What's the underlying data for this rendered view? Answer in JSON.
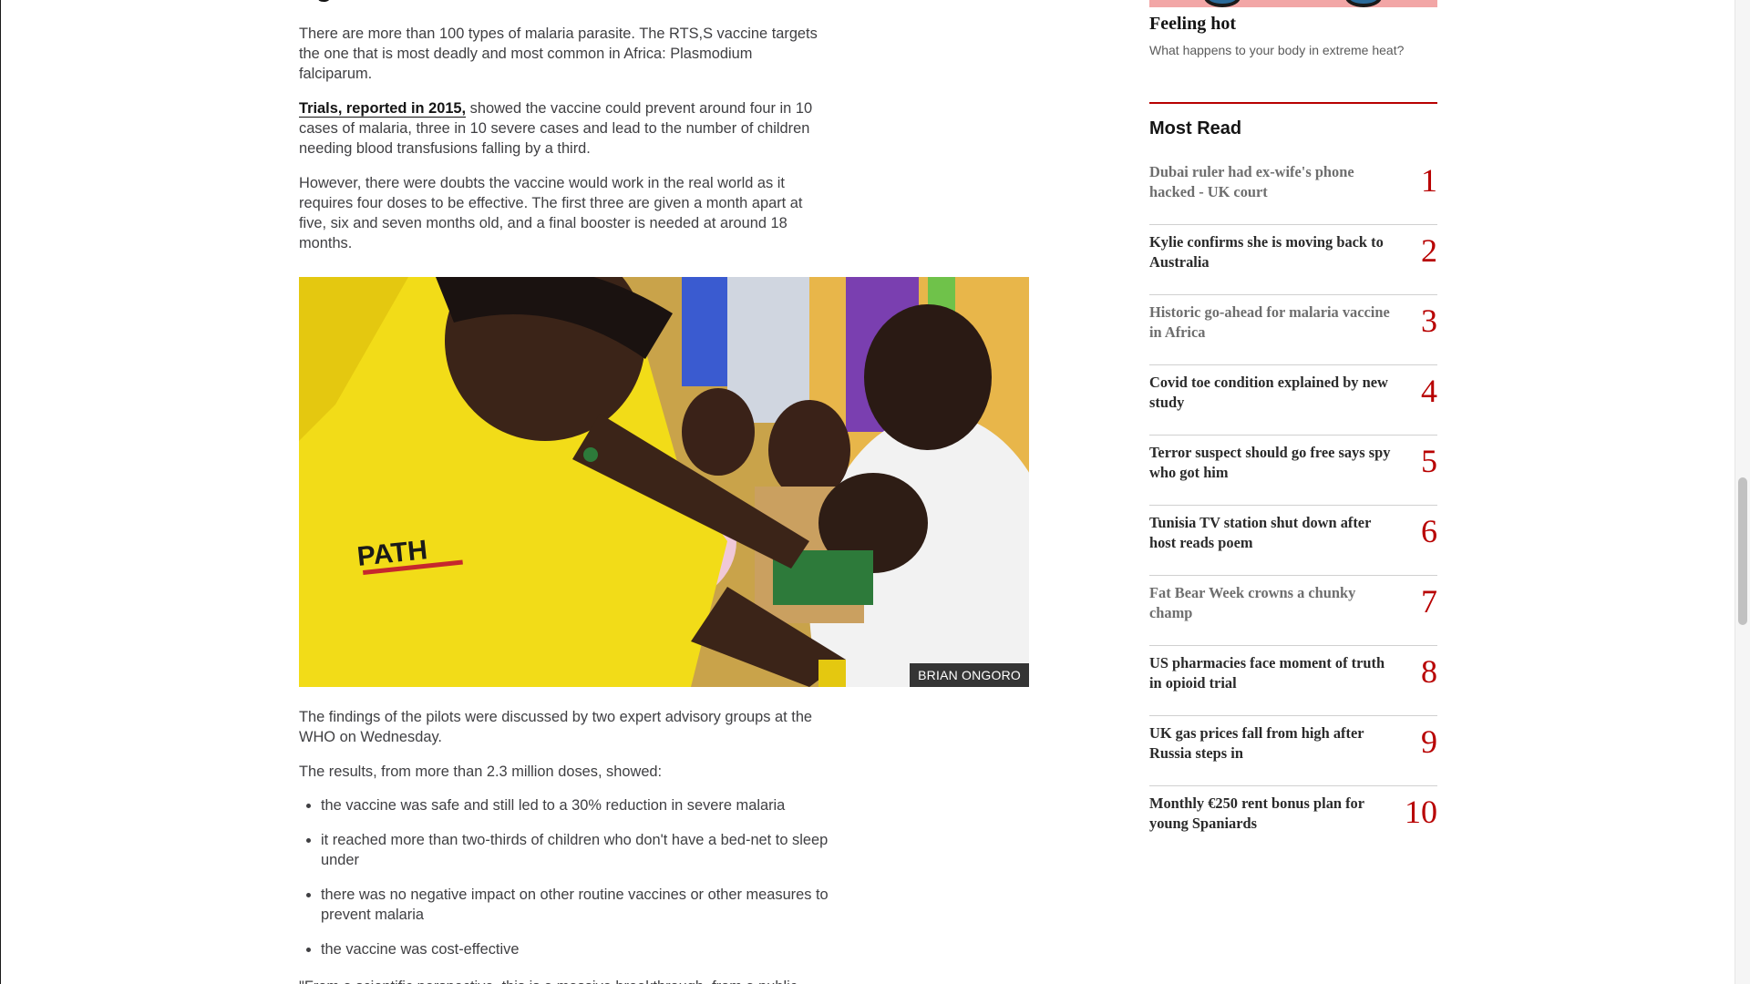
{
  "article": {
    "heading_partial": "ng",
    "paragraphs": [
      "There are more than 100 types of malaria parasite. The RTS,S vaccine targets the one that is most deadly and most common in Africa: Plasmodium falciparum.",
      "However, there were doubts the vaccine would work in the real world as it requires four doses to be effective. The first three are given a month apart at five, six and seven months old, and a final booster is needed at around 18 months."
    ],
    "trials_link": "Trials, reported in 2015,",
    "trials_rest": " showed the vaccine could prevent around four in 10 cases of malaria, three in 10 severe cases and lead to the number of children needing blood transfusions falling by a third.",
    "photo": {
      "credit": "BRIAN ONGORO",
      "shirt_text": "PATH"
    },
    "after_photo": [
      "The findings of the pilots were discussed by two expert advisory groups at the WHO on Wednesday.",
      "The results, from more than 2.3 million doses, showed:"
    ],
    "bullets": [
      "the vaccine was safe and still led to a 30% reduction in severe malaria",
      "it reached more than two-thirds of children who don't have a bed-net to sleep under",
      "there was no negative impact on other routine vaccines or other measures to prevent malaria",
      "the vaccine was cost-effective"
    ],
    "cutoff_line": "\"From a scientific perspective, this is a massive breakthrough, from a public"
  },
  "sidebar": {
    "promo": {
      "title": "Feeling hot",
      "subtitle": "What happens to your body in extreme heat?"
    },
    "most_read": {
      "heading": "Most Read",
      "items": [
        {
          "rank": "1",
          "title": "Dubai ruler had ex-wife's phone hacked - UK court",
          "visited": true
        },
        {
          "rank": "2",
          "title": "Kylie confirms she is moving back to Australia",
          "visited": false
        },
        {
          "rank": "3",
          "title": "Historic go-ahead for malaria vaccine in Africa",
          "visited": true
        },
        {
          "rank": "4",
          "title": "Covid toe condition explained by new study",
          "visited": false
        },
        {
          "rank": "5",
          "title": "Terror suspect should go free says spy who got him",
          "visited": false
        },
        {
          "rank": "6",
          "title": "Tunisia TV station shut down after host reads poem",
          "visited": false
        },
        {
          "rank": "7",
          "title": "Fat Bear Week crowns a chunky champ",
          "visited": true
        },
        {
          "rank": "8",
          "title": "US pharmacies face moment of truth in opioid trial",
          "visited": false
        },
        {
          "rank": "9",
          "title": "UK gas prices fall from high after Russia steps in",
          "visited": false
        },
        {
          "rank": "10",
          "title": "Monthly €250 rent bonus plan for young Spaniards",
          "visited": false
        }
      ]
    }
  },
  "colors": {
    "accent_red": "#b80000",
    "text": "#3f3f42",
    "heading": "#141414",
    "visited": "#6e6e6e"
  }
}
